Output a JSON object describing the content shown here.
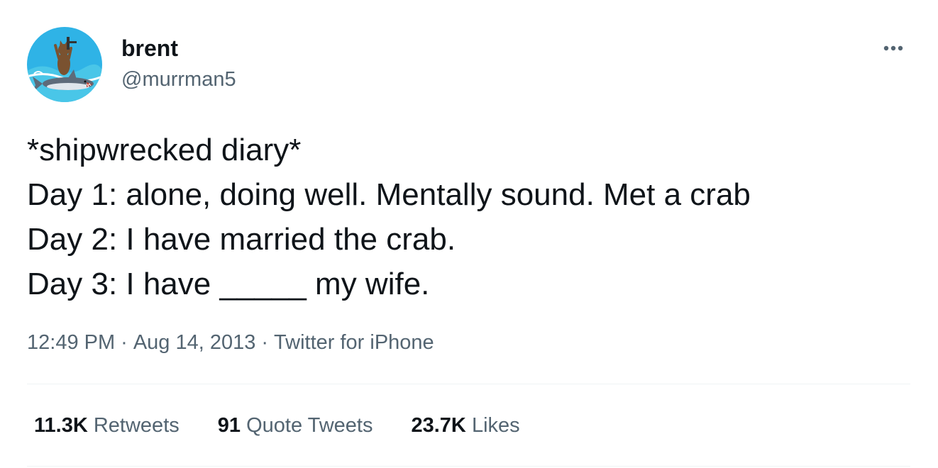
{
  "author": {
    "display_name": "brent",
    "handle": "@murrman5",
    "avatar_icon": "avatar-cat-on-shark"
  },
  "tweet": {
    "lines": [
      "*shipwrecked diary*",
      "Day 1: alone, doing well. Mentally sound. Met a crab",
      "Day 2: I have married the crab.",
      "Day 3: I have _____ my wife."
    ]
  },
  "meta": {
    "time": "12:49 PM",
    "separator": "·",
    "date": "Aug 14, 2013",
    "source": "Twitter for iPhone"
  },
  "stats": {
    "retweets_count": "11.3K",
    "retweets_label": "Retweets",
    "quotes_count": "91",
    "quotes_label": "Quote Tweets",
    "likes_count": "23.7K",
    "likes_label": "Likes"
  },
  "colors": {
    "text_primary": "#0f1419",
    "text_secondary": "#536471",
    "divider": "#eff3f4"
  }
}
